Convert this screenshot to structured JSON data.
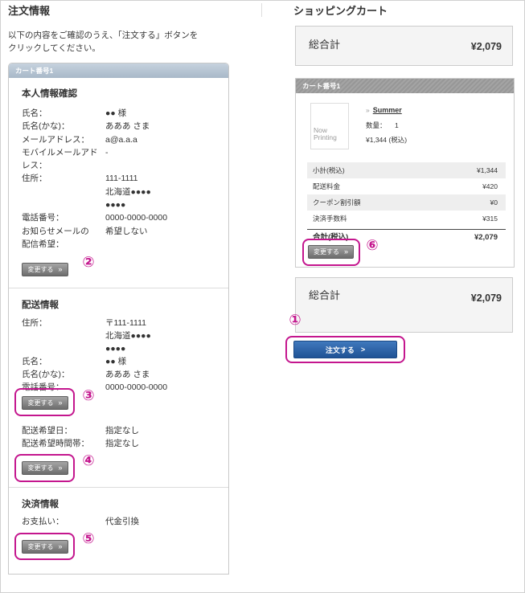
{
  "colors": {
    "annotation": "#c4168e",
    "order_button": "#1f5295",
    "order_header_top": "#c6d2de",
    "order_header_bottom": "#a8b8c8",
    "text": "#333333"
  },
  "order_info": {
    "title": "注文情報",
    "intro": "以下の内容をご確認のうえ、「注文する」ボタンを\nクリックしてください。",
    "cart_label": "カート番号1",
    "personal": {
      "heading": "本人情報確認",
      "rows": [
        {
          "label": "氏名：",
          "value": "●● 様"
        },
        {
          "label": "氏名(かな)：",
          "value": "あああ さま"
        },
        {
          "label": "メールアドレス：",
          "value": "a@a.a.a"
        },
        {
          "label": "モバイルメールアド\nレス：",
          "value": "-"
        },
        {
          "label": "住所：",
          "value": "111-1111\n北海道●●●●\n●●●●"
        },
        {
          "label": "電話番号：",
          "value": "0000-0000-0000"
        },
        {
          "label": "お知らせメールの\n配信希望：",
          "value": "希望しない"
        }
      ]
    },
    "delivery": {
      "heading": "配送情報",
      "rows": [
        {
          "label": "住所：",
          "value": "〒111-1111\n北海道●●●●\n●●●●"
        },
        {
          "label": "氏名：",
          "value": "●● 様"
        },
        {
          "label": "氏名(かな)：",
          "value": "あああ さま"
        },
        {
          "label": "電話番号：",
          "value": "0000-0000-0000"
        }
      ],
      "schedule_rows": [
        {
          "label": "配送希望日：",
          "value": "指定なし"
        },
        {
          "label": "配送希望時間帯：",
          "value": "指定なし"
        }
      ]
    },
    "payment": {
      "heading": "決済情報",
      "rows": [
        {
          "label": "お支払い：",
          "value": "代金引換"
        }
      ]
    }
  },
  "buttons": {
    "change_label": "変更する",
    "change_arrow": "»",
    "order_label": "注文する",
    "order_arrow": ">"
  },
  "cart": {
    "title": "ショッピングカート",
    "grand_total_label": "総合計",
    "grand_total_value": "¥2,079",
    "cart_label": "カート番号1",
    "item": {
      "image_placeholder": "Now\nPrinting",
      "link_arrow": "»",
      "name": "Summer",
      "quantity_label": "数量：",
      "quantity": "1",
      "price": "¥1,344 (税込)"
    },
    "summary": [
      {
        "label": "小計(税込)",
        "value": "¥1,344"
      },
      {
        "label": "配送料金",
        "value": "¥420"
      },
      {
        "label": "クーポン割引額",
        "value": "¥0"
      },
      {
        "label": "決済手数料",
        "value": "¥315"
      }
    ],
    "total": {
      "label": "合計(税込)",
      "value": "¥2,079"
    }
  },
  "annotations": [
    "①",
    "②",
    "③",
    "④",
    "⑤",
    "⑥"
  ]
}
